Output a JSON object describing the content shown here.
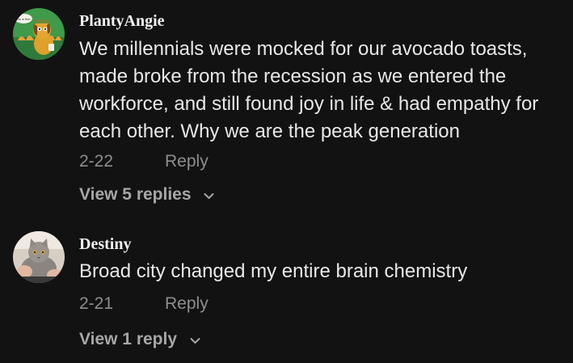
{
  "comments": [
    {
      "username": "PlantyAngie",
      "avatar_icon": "cartoon-dog-this-is-fine-avatar",
      "avatar_speech_text": "this is fine.",
      "text": "We millennials were mocked for our avocado toasts, made broke from the recession as we entered the workforce, and still found joy in life & had empathy for each other. Why we are the peak generation",
      "date": "2-22",
      "reply_label": "Reply",
      "view_replies_label": "View 5 replies",
      "chevron_icon": "chevron-down-icon"
    },
    {
      "username": "Destiny",
      "avatar_icon": "cat-photo-avatar",
      "text": "Broad city changed my entire brain chemistry",
      "date": "2-21",
      "reply_label": "Reply",
      "view_replies_label": "View 1 reply",
      "chevron_icon": "chevron-down-icon"
    }
  ],
  "colors": {
    "background": "#121212",
    "primary_text": "#e8e8e8",
    "secondary_text": "#8e8e8e",
    "view_replies_text": "#a6a6a6"
  }
}
